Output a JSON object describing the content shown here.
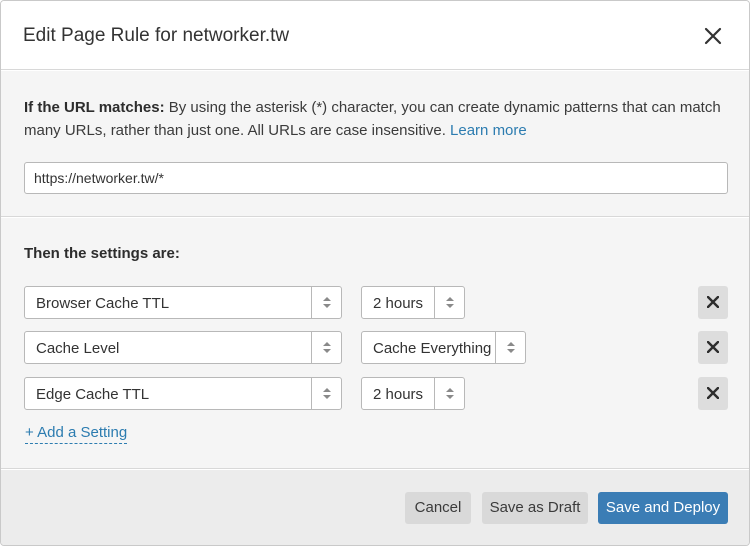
{
  "dialog": {
    "title": "Edit Page Rule for networker.tw"
  },
  "url_section": {
    "label_bold": "If the URL matches:",
    "description": " By using the asterisk (*) character, you can create dynamic patterns that can match many URLs, rather than just one. All URLs are case insensitive. ",
    "learn_more": "Learn more",
    "url_value": "https://networker.tw/*"
  },
  "settings_section": {
    "label": "Then the settings are:",
    "rows": [
      {
        "setting": "Browser Cache TTL",
        "value": "2 hours"
      },
      {
        "setting": "Cache Level",
        "value": "Cache Everything"
      },
      {
        "setting": "Edge Cache TTL",
        "value": "2 hours"
      }
    ],
    "add_setting": "+ Add a Setting"
  },
  "footer": {
    "cancel": "Cancel",
    "save_draft": "Save as Draft",
    "save_deploy": "Save and Deploy"
  },
  "colors": {
    "link": "#2c7cb0",
    "primary_button": "#3b7db5",
    "section_bg": "#f5f5f5",
    "footer_bg": "#ececec"
  }
}
